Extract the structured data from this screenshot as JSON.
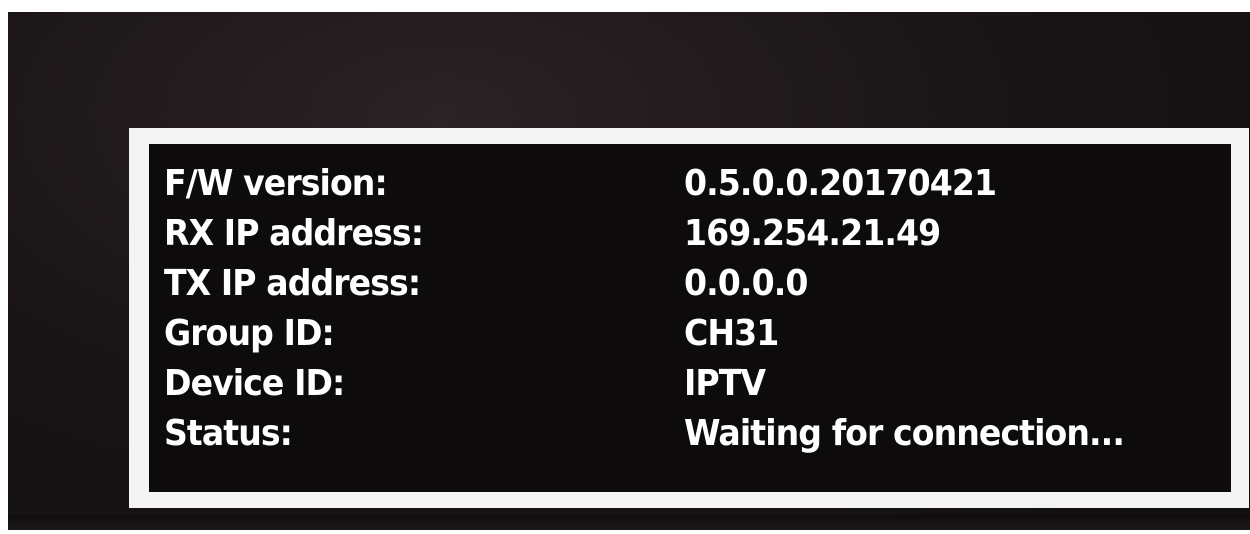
{
  "info_panel": {
    "rows": [
      {
        "label": "F/W version:",
        "value": "0.5.0.0.20170421"
      },
      {
        "label": "RX IP address:",
        "value": "169.254.21.49"
      },
      {
        "label": "TX IP address:",
        "value": "0.0.0.0"
      },
      {
        "label": "Group ID:",
        "value": "CH31"
      },
      {
        "label": "Device ID:",
        "value": "IPTV"
      },
      {
        "label": "Status:",
        "value": "Waiting for connection..."
      }
    ]
  },
  "colors": {
    "text": "#ffffff",
    "panel_border": "#f4f4f4",
    "panel_background": "#0d0b0c",
    "screen_background": "#1a1517"
  }
}
